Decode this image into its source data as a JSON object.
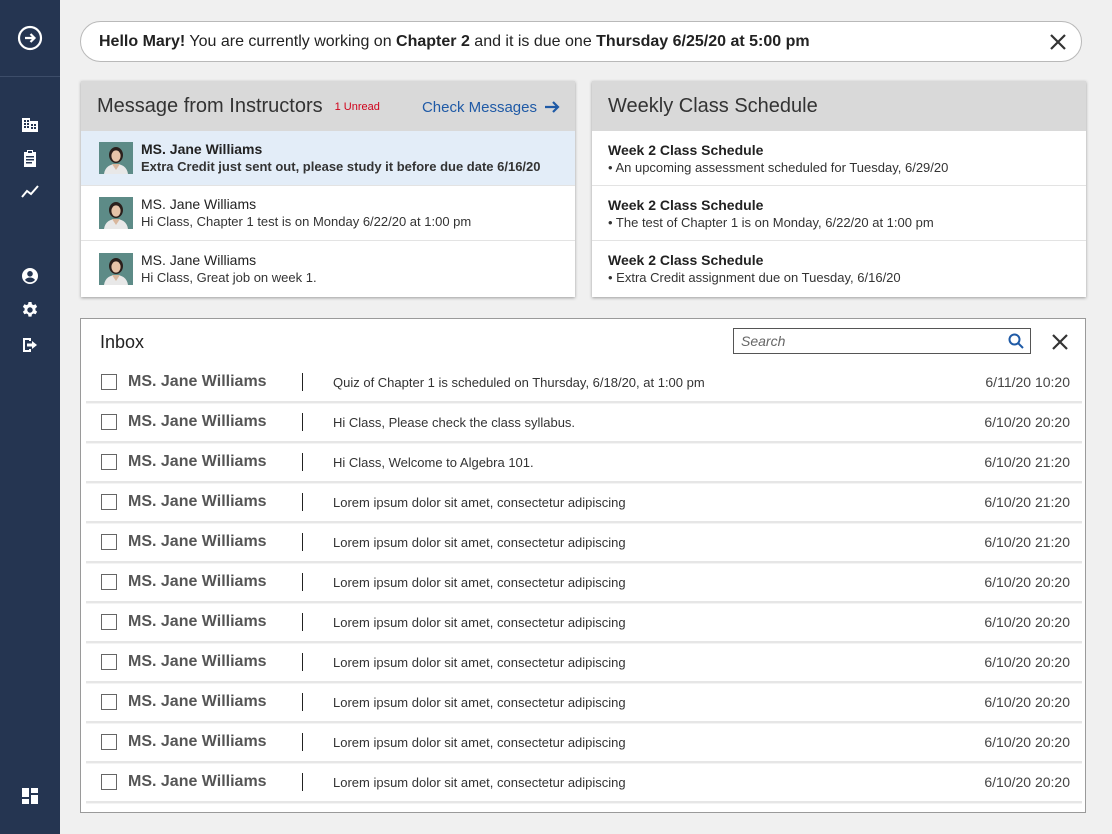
{
  "colors": {
    "sidebar_bg": "#253551",
    "accent_link": "#1f5aa6",
    "unread_red": "#d0021b",
    "highlight_row": "#e3edf8",
    "card_header": "#d9d9d9"
  },
  "sidebar": {
    "top_icon": "arrow-circle-right-icon",
    "items": [
      {
        "icon": "building-icon"
      },
      {
        "icon": "clipboard-icon"
      },
      {
        "icon": "trend-chart-icon"
      },
      {
        "icon": "user-icon"
      },
      {
        "icon": "gear-icon"
      },
      {
        "icon": "logout-icon"
      }
    ],
    "bottom_icon": "dashboard-icon"
  },
  "greeting": {
    "hello": "Hello Mary!",
    "text1": " You are currently working on ",
    "chapter": "Chapter 2",
    "text2": " and it is due one ",
    "due": "Thursday 6/25/20 at 5:00 pm",
    "close_icon": "close-icon"
  },
  "instructors": {
    "title": "Message from Instructors",
    "unread": "1 Unread",
    "check_label": "Check Messages",
    "messages": [
      {
        "name": "MS. Jane Williams",
        "body": "Extra Credit just sent out, please study it before due date 6/16/20",
        "unread": true
      },
      {
        "name": "MS. Jane Williams",
        "body": "Hi Class, Chapter 1 test is on Monday 6/22/20 at 1:00 pm",
        "unread": false
      },
      {
        "name": "MS. Jane Williams",
        "body": "Hi Class, Great job on week 1.",
        "unread": false
      }
    ]
  },
  "schedule": {
    "title": "Weekly Class Schedule",
    "items": [
      {
        "title": "Week 2 Class Schedule",
        "sub": "• An upcoming assessment scheduled for Tuesday, 6/29/20"
      },
      {
        "title": "Week 2 Class Schedule",
        "sub": "• The test of Chapter 1 is on Monday, 6/22/20 at 1:00 pm"
      },
      {
        "title": "Week 2 Class Schedule",
        "sub": "• Extra Credit assignment due on Tuesday, 6/16/20"
      }
    ]
  },
  "inbox": {
    "title": "Inbox",
    "search_placeholder": "Search",
    "rows": [
      {
        "sender": "MS. Jane Williams",
        "subject": "Quiz of Chapter 1 is scheduled on Thursday, 6/18/20, at 1:00 pm",
        "date": "6/11/20 10:20"
      },
      {
        "sender": "MS. Jane Williams",
        "subject": "Hi Class, Please check the class syllabus.",
        "date": "6/10/20 20:20"
      },
      {
        "sender": "MS. Jane Williams",
        "subject": "Hi Class, Welcome to Algebra 101.",
        "date": "6/10/20 21:20"
      },
      {
        "sender": "MS. Jane Williams",
        "subject": "Lorem ipsum dolor sit amet, consectetur adipiscing",
        "date": "6/10/20 21:20"
      },
      {
        "sender": "MS. Jane Williams",
        "subject": "Lorem ipsum dolor sit amet, consectetur adipiscing",
        "date": "6/10/20 21:20"
      },
      {
        "sender": "MS. Jane Williams",
        "subject": "Lorem ipsum dolor sit amet, consectetur adipiscing",
        "date": "6/10/20 20:20"
      },
      {
        "sender": "MS. Jane Williams",
        "subject": "Lorem ipsum dolor sit amet, consectetur adipiscing",
        "date": "6/10/20 20:20"
      },
      {
        "sender": "MS. Jane Williams",
        "subject": "Lorem ipsum dolor sit amet, consectetur adipiscing",
        "date": "6/10/20 20:20"
      },
      {
        "sender": "MS. Jane Williams",
        "subject": "Lorem ipsum dolor sit amet, consectetur adipiscing",
        "date": "6/10/20 20:20"
      },
      {
        "sender": "MS. Jane Williams",
        "subject": "Lorem ipsum dolor sit amet, consectetur adipiscing",
        "date": "6/10/20 20:20"
      },
      {
        "sender": "MS. Jane Williams",
        "subject": "Lorem ipsum dolor sit amet, consectetur adipiscing",
        "date": "6/10/20 20:20"
      }
    ]
  }
}
